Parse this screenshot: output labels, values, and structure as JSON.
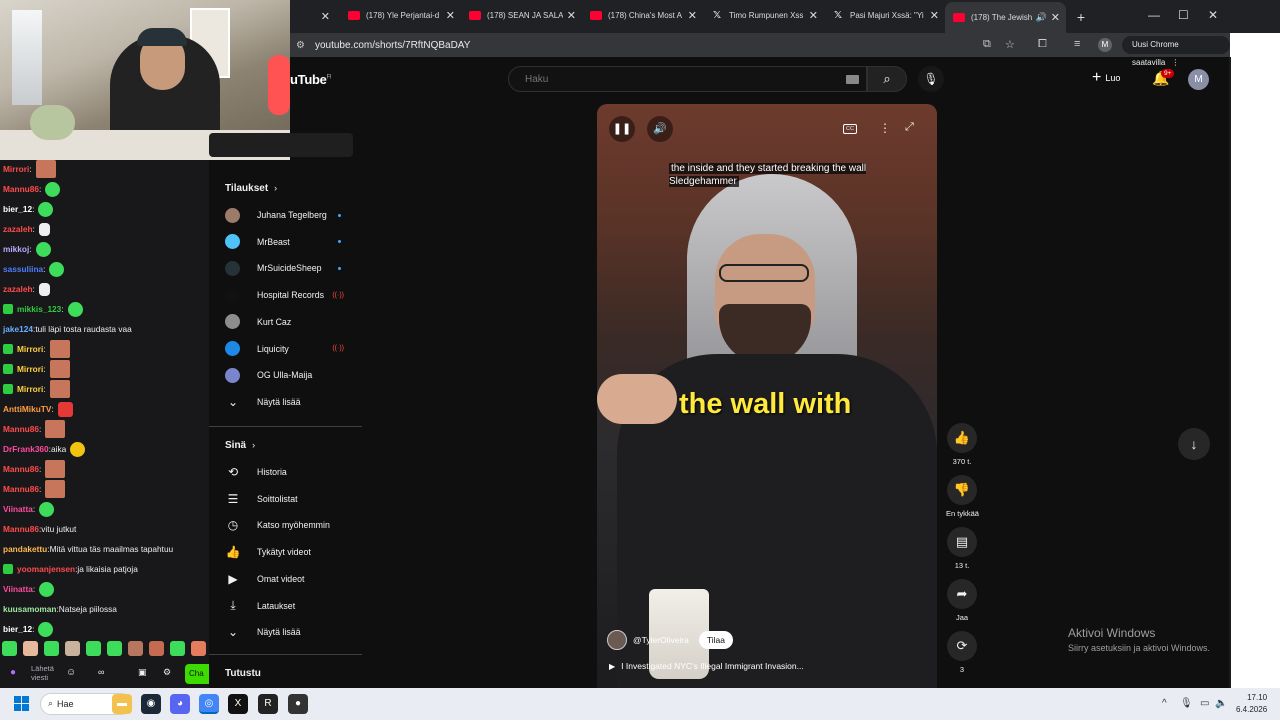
{
  "browser": {
    "tabs": [
      {
        "title": "(178) Yle Perjantai-d",
        "type": "youtube"
      },
      {
        "title": "(178) SEAN JA SALA",
        "type": "youtube"
      },
      {
        "title": "(178) China's Most A",
        "type": "youtube"
      },
      {
        "title": "Timo Rumpunen Xss",
        "type": "x"
      },
      {
        "title": "Pasi Majuri Xssä: \"Yi",
        "type": "x"
      },
      {
        "title": "(178) The Jewish",
        "type": "youtube",
        "active": true
      }
    ],
    "url": "youtube.com/shorts/7RftNQBaDAY",
    "profile_initial": "M",
    "update_label": "Uusi Chrome saatavilla"
  },
  "chat": {
    "messages": [
      {
        "user": "Mirrori",
        "text": "",
        "color": "#ff4b4b",
        "emote": "face"
      },
      {
        "user": "Mannu86",
        "text": "",
        "color": "#ff4b4b",
        "emote": "frog"
      },
      {
        "user": "bier_12",
        "text": "",
        "color": "#ffffff",
        "emote": "frog"
      },
      {
        "user": "zazaleh",
        "text": "",
        "color": "#ff4b4b",
        "emote": "skull"
      },
      {
        "user": "mikkoj",
        "text": "",
        "color": "#b8a9ff",
        "emote": "frog"
      },
      {
        "user": "sassuliina",
        "text": "",
        "color": "#4f7cff",
        "emote": "frog"
      },
      {
        "user": "zazaleh",
        "text": "",
        "color": "#ff4b4b",
        "emote": "skull"
      },
      {
        "user": "mikkis_123",
        "text": "",
        "color": "#2ecc40",
        "emote": "frog",
        "badge": true
      },
      {
        "user": "jake124",
        "text": "tuli läpi tosta raudasta vaa",
        "color": "#6ab0ff",
        "emote": ""
      },
      {
        "user": "Mirrori",
        "text": "",
        "color": "#ffd23f",
        "emote": "face",
        "badge": true
      },
      {
        "user": "Mirrori",
        "text": "",
        "color": "#ffd23f",
        "emote": "face",
        "badge": true
      },
      {
        "user": "Mirrori",
        "text": "",
        "color": "#ffd23f",
        "emote": "face",
        "badge": true
      },
      {
        "user": "AnttiMikuTV",
        "text": "",
        "color": "#ff9e3f",
        "emote": "red"
      },
      {
        "user": "Mannu86",
        "text": "",
        "color": "#ff4b4b",
        "emote": "face"
      },
      {
        "user": "DrFrank360",
        "text": "aika",
        "color": "#ff4b9e",
        "emote": "gold"
      },
      {
        "user": "Mannu86",
        "text": "",
        "color": "#ff4b4b",
        "emote": "face"
      },
      {
        "user": "Mannu86",
        "text": "",
        "color": "#ff4b4b",
        "emote": "face"
      },
      {
        "user": "Viinatta",
        "text": "",
        "color": "#ff4b9e",
        "emote": "frog"
      },
      {
        "user": "Mannu86",
        "text": "vitu jutkut",
        "color": "#ff4b4b",
        "emote": ""
      },
      {
        "user": "pandakettu",
        "text": "Mitä vittua täs maailmas tapahtuu",
        "color": "#ffb84d",
        "emote": ""
      },
      {
        "user": "yoomanjensen",
        "text": "ja likaisia patjoja",
        "color": "#ff4b4b",
        "emote": "",
        "badge": true
      },
      {
        "user": "Viinatta",
        "text": "",
        "color": "#ff4b9e",
        "emote": "frog"
      },
      {
        "user": "kuusamoman",
        "text": "Natseja piilossa",
        "color": "#9fe6a0",
        "emote": ""
      },
      {
        "user": "bier_12",
        "text": "",
        "color": "#ffffff",
        "emote": "frog"
      }
    ],
    "input_placeholder": "Lähetä viesti",
    "chat_button": "Cha"
  },
  "youtube": {
    "logo": "uTube",
    "logo_region": "FI",
    "search_placeholder": "Haku",
    "create_label": "Luo",
    "notif_count": "9+",
    "avatar_initial": "M",
    "subscriptions_title": "Tilaukset",
    "subscriptions": [
      {
        "name": "Juhana Tegelberg",
        "indicator": "dot",
        "color": "#9c7b6b"
      },
      {
        "name": "MrBeast",
        "indicator": "dot",
        "color": "#4fc3f7"
      },
      {
        "name": "MrSuicideSheep",
        "indicator": "dot",
        "color": "#263238"
      },
      {
        "name": "Hospital Records",
        "indicator": "live",
        "color": "#111111"
      },
      {
        "name": "Kurt Caz",
        "indicator": "",
        "color": "#8d8d8d"
      },
      {
        "name": "Liquicity",
        "indicator": "live",
        "color": "#1e88e5"
      },
      {
        "name": "OG Ulla-Maija",
        "indicator": "",
        "color": "#7986cb"
      }
    ],
    "show_more": "Näytä lisää",
    "you_title": "Sinä",
    "you_items": [
      {
        "label": "Historia",
        "icon": "history-icon"
      },
      {
        "label": "Soittolistat",
        "icon": "playlist-icon"
      },
      {
        "label": "Katso myöhemmin",
        "icon": "clock-icon"
      },
      {
        "label": "Tykätyt videot",
        "icon": "thumb-up-icon"
      },
      {
        "label": "Omat videot",
        "icon": "video-icon"
      },
      {
        "label": "Lataukset",
        "icon": "download-icon"
      }
    ],
    "show_more_2": "Näytä lisää",
    "explore_title": "Tutustu"
  },
  "short": {
    "caption_small": "the inside and they started breaking the wall Sledgehammer",
    "caption_big": "the wall with",
    "cc": "CC",
    "channel": "@TylerOliveira",
    "subscribe": "Tilaa",
    "title": "I Investigated NYC's Illegal Immigrant Invasion...",
    "likes": "370 t.",
    "dislike_label": "En tykkää",
    "comments": "13 t.",
    "share_label": "Jaa",
    "remix_count": "3"
  },
  "windows": {
    "activate_title": "Aktivoi Windows",
    "activate_sub": "Siirry asetuksiin ja aktivoi Windows.",
    "search": "Hae",
    "time": "17.10",
    "date": "6.4.2026"
  }
}
